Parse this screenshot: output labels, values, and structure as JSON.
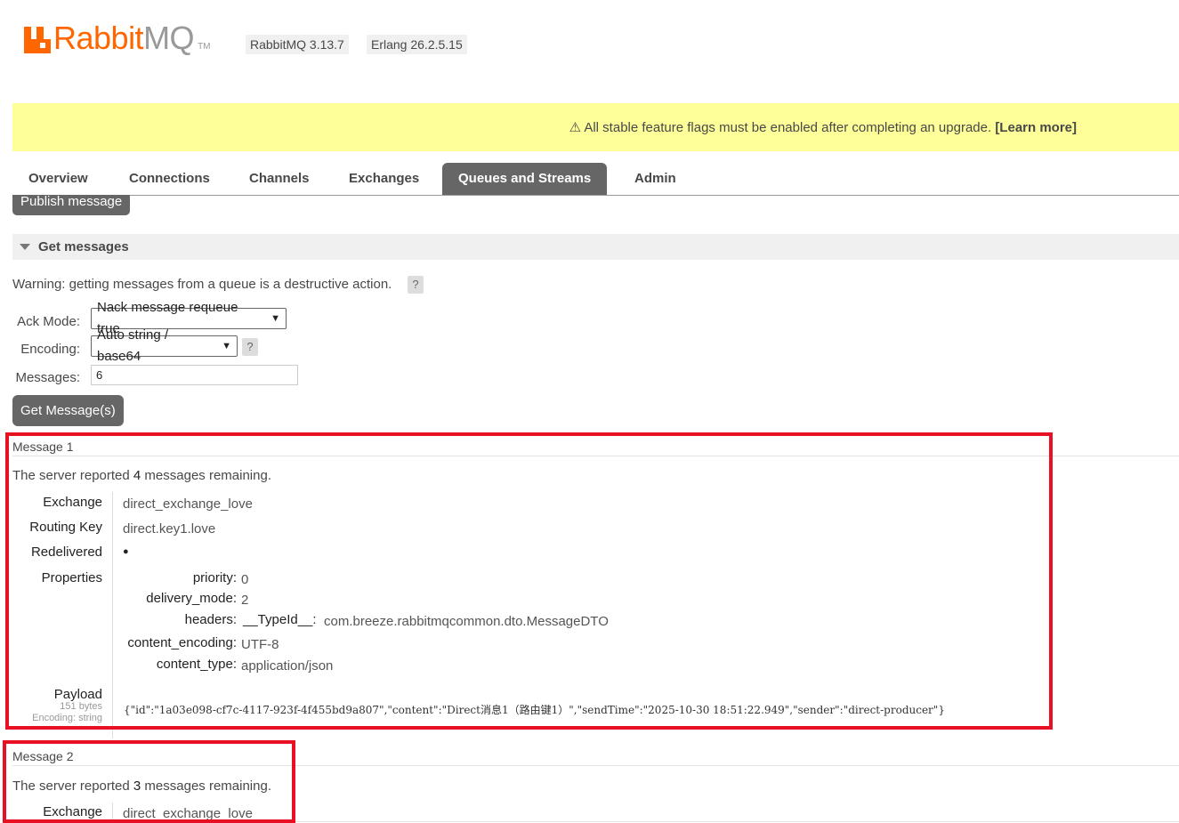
{
  "header": {
    "brand_rabbit": "Rabbit",
    "brand_mq": "MQ",
    "brand_tm": "TM",
    "rabbitmq_version": "RabbitMQ 3.13.7",
    "erlang_version": "Erlang 26.2.5.15"
  },
  "banner": {
    "text": "⚠ All stable feature flags must be enabled after completing an upgrade.",
    "link": "[Learn more]"
  },
  "tabs": [
    {
      "label": "Overview"
    },
    {
      "label": "Connections"
    },
    {
      "label": "Channels"
    },
    {
      "label": "Exchanges"
    },
    {
      "label": "Queues and Streams",
      "active": true
    },
    {
      "label": "Admin"
    }
  ],
  "publish_button": "Publish message",
  "get_messages": {
    "title": "Get messages",
    "warning": "Warning: getting messages from a queue is a destructive action.",
    "help": "?",
    "ack_mode_label": "Ack Mode:",
    "ack_mode_value": "Nack message requeue true",
    "encoding_label": "Encoding:",
    "encoding_value": "Auto string / base64",
    "messages_label": "Messages:",
    "messages_value": "6",
    "get_button": "Get Message(s)"
  },
  "messages": [
    {
      "title": "Message 1",
      "remaining_prefix": "The server reported",
      "remaining_count": "4",
      "remaining_suffix": "messages remaining.",
      "exchange_label": "Exchange",
      "exchange": "direct_exchange_love",
      "routing_key_label": "Routing Key",
      "routing_key": "direct.key1.love",
      "redelivered_label": "Redelivered",
      "redelivered": "●",
      "properties_label": "Properties",
      "properties": {
        "priority_key": "priority:",
        "priority": "0",
        "delivery_mode_key": "delivery_mode:",
        "delivery_mode": "2",
        "headers_key": "headers:",
        "header_name": "__TypeId__:",
        "header_value": "com.breeze.rabbitmqcommon.dto.MessageDTO",
        "content_encoding_key": "content_encoding:",
        "content_encoding": "UTF-8",
        "content_type_key": "content_type:",
        "content_type": "application/json"
      },
      "payload_label": "Payload",
      "payload_size": "151 bytes",
      "payload_encoding": "Encoding: string",
      "payload": "{\"id\":\"1a03e098-cf7c-4117-923f-4f455bd9a807\",\"content\":\"Direct消息1（路由键1）\",\"sendTime\":\"2025-10-30 18:51:22.949\",\"sender\":\"direct-producer\"}"
    },
    {
      "title": "Message 2",
      "remaining_prefix": "The server reported",
      "remaining_count": "3",
      "remaining_suffix": "messages remaining.",
      "exchange_label": "Exchange",
      "exchange": "direct_exchange_love"
    }
  ],
  "colors": {
    "brand_orange": "#ff6600",
    "banner_yellow": "#ffff99",
    "tab_active": "#666666",
    "highlight_red": "#e81123"
  }
}
